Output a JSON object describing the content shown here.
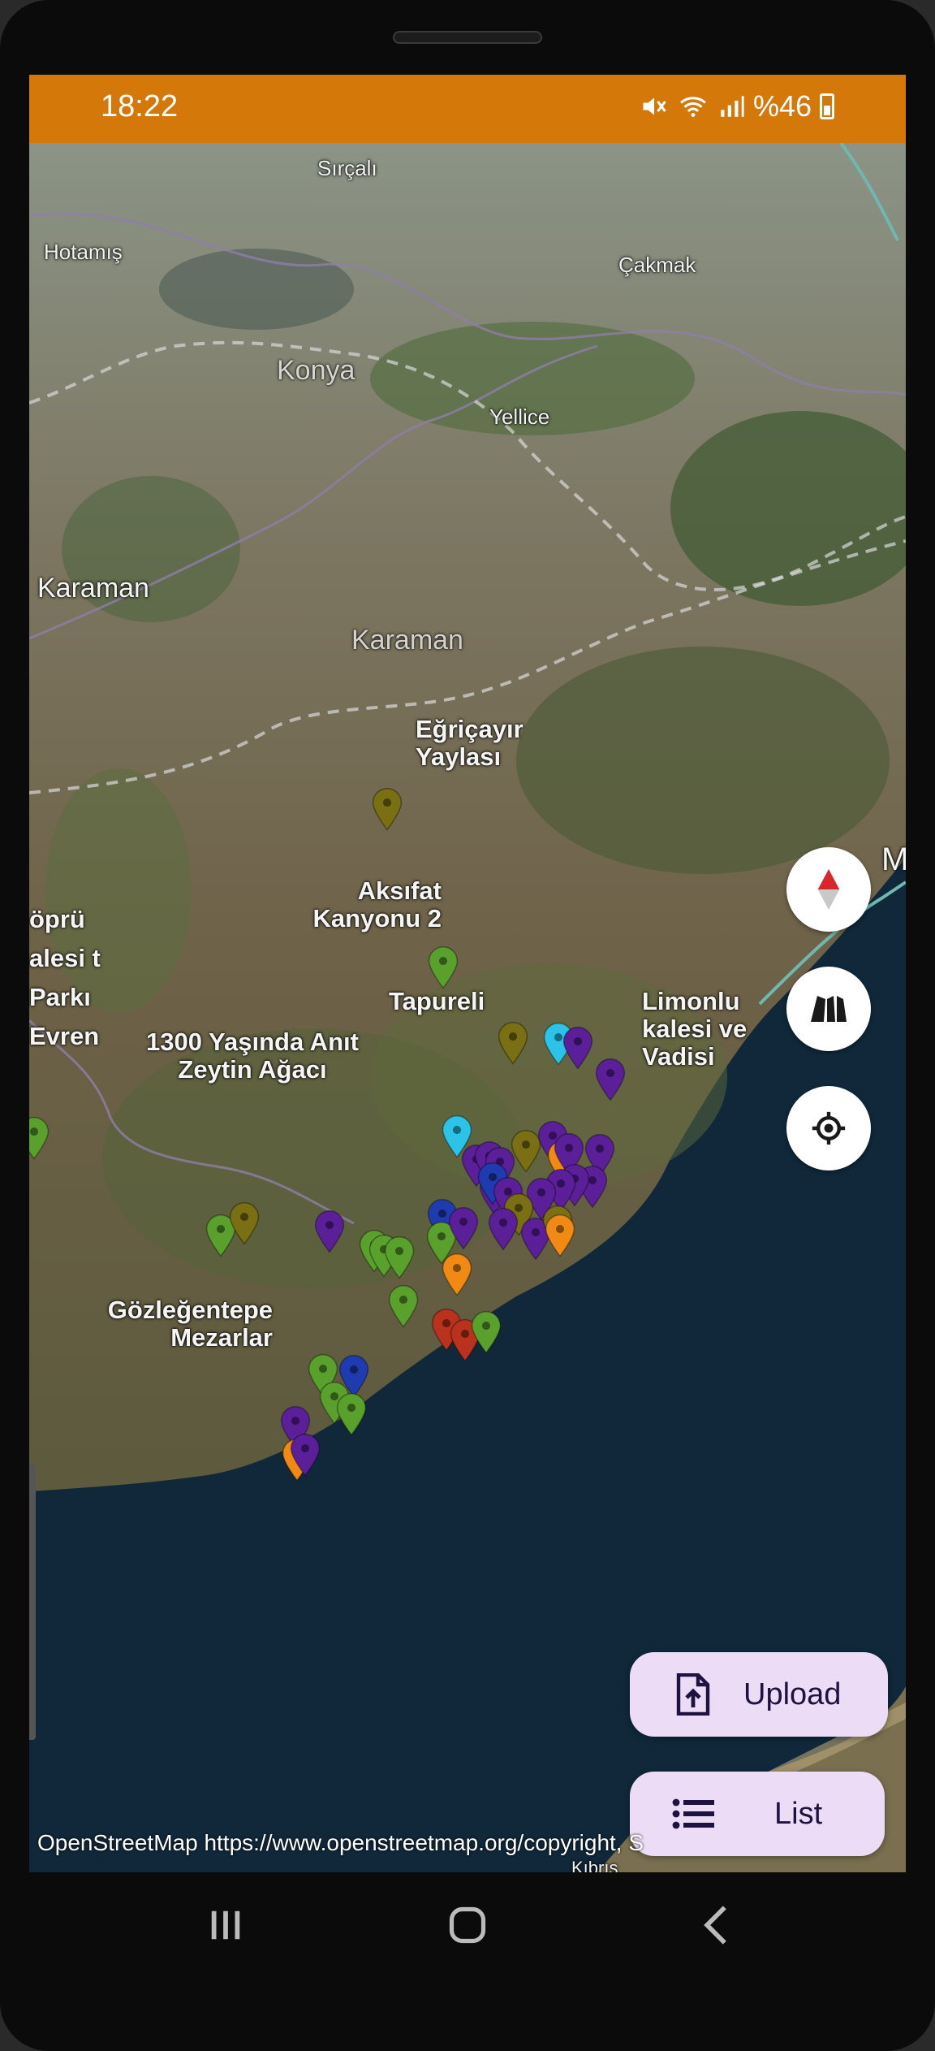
{
  "status_bar": {
    "time": "18:22",
    "mute_icon": "mute-icon",
    "wifi_icon": "wifi-icon",
    "signal_icon": "signal-icon",
    "battery_text": "%46",
    "color": "#d4780a"
  },
  "map": {
    "labels": [
      {
        "text": "Sırçalı",
        "kind": "town"
      },
      {
        "text": "Hotamış",
        "kind": "town"
      },
      {
        "text": "Çakmak",
        "kind": "town"
      },
      {
        "text": "Konya",
        "kind": "region"
      },
      {
        "text": "Yellice",
        "kind": "town"
      },
      {
        "text": "Karaman",
        "kind": "city"
      },
      {
        "text": "Karaman",
        "kind": "region"
      },
      {
        "text": "Eğriçayır Yaylası",
        "kind": "poi"
      },
      {
        "text": "Aksıfat Kanyonu 2",
        "kind": "poi"
      },
      {
        "text": "Tapureli",
        "kind": "poi"
      },
      {
        "text": "Limonlu kalesi ve Vadisi",
        "kind": "poi"
      },
      {
        "text": "1300 Yaşında Anıt Zeytin Ağacı",
        "kind": "poi"
      },
      {
        "text": "Gözleğentepe Mezarlar",
        "kind": "poi"
      },
      {
        "text": "öprü alesi t Parkı Evren",
        "kind": "poi"
      },
      {
        "text": "M",
        "kind": "city"
      },
      {
        "text": "Kıbrıs",
        "kind": "town"
      }
    ],
    "marker_colors": {
      "green": "#5aa02c",
      "olive": "#7a6f12",
      "purple": "#5a1f99",
      "blue": "#1f3bb0",
      "cyan": "#2bc4e8",
      "orange": "#f08a12",
      "red": "#b8321e"
    },
    "attribution": "OpenStreetMap https://www.openstreetmap.org/copyright, S"
  },
  "controls": {
    "compass_icon": "compass-icon",
    "map_type_icon": "map-layers-icon",
    "locate_icon": "my-location-icon"
  },
  "fabs": {
    "upload_label": "Upload",
    "upload_icon": "file-upload-icon",
    "list_label": "List",
    "list_icon": "list-icon"
  },
  "nav": {
    "recents_icon": "recents-icon",
    "home_icon": "home-icon",
    "back_icon": "back-icon"
  }
}
